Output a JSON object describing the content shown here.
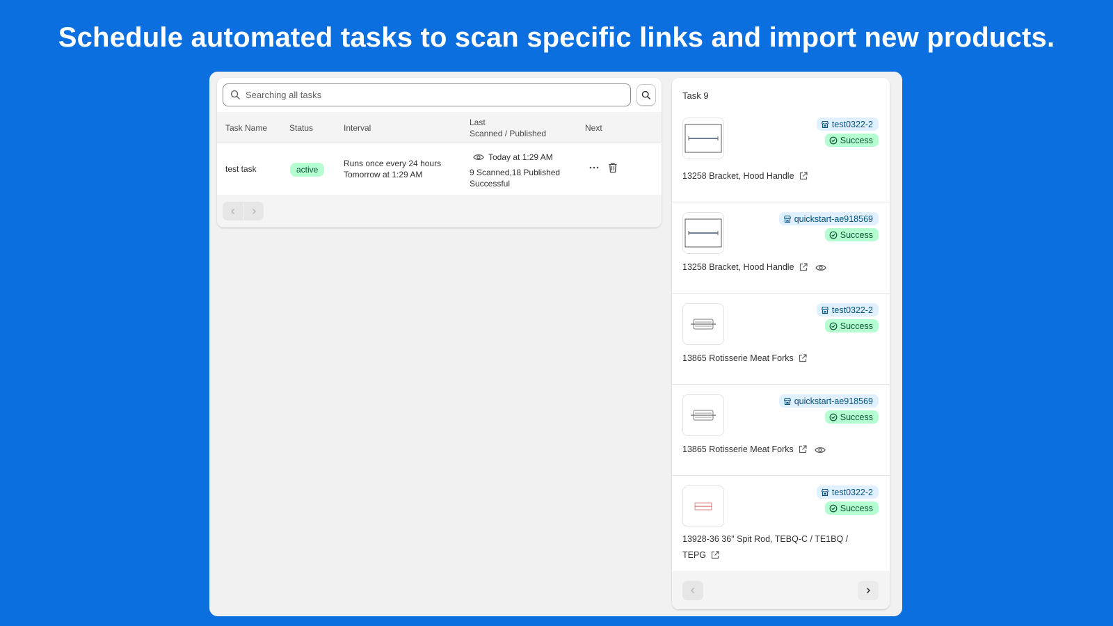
{
  "headline": "Schedule automated tasks to scan specific links and import new products.",
  "search": {
    "placeholder": "Searching all tasks"
  },
  "table": {
    "headers": {
      "task_name": "Task Name",
      "status": "Status",
      "interval": "Interval",
      "last_line1": "Last",
      "last_line2": "Scanned / Published",
      "next": "Next"
    },
    "rows": [
      {
        "task_name": "test task",
        "status": "active",
        "interval_line1": "Runs once every 24 hours",
        "interval_line2": "Tomorrow at 1:29 AM",
        "last_time": "Today at 1:29 AM",
        "last_counts": "9 Scanned,18 Published",
        "last_result": "Successful"
      }
    ]
  },
  "detail": {
    "title": "Task 9",
    "items": [
      {
        "store": "test0322-2",
        "status": "Success",
        "name": "13258 Bracket, Hood Handle",
        "thumb": "bracket-image",
        "show_eye": false
      },
      {
        "store": "quickstart-ae918569",
        "status": "Success",
        "name": "13258 Bracket, Hood Handle",
        "thumb": "bracket-image",
        "show_eye": true
      },
      {
        "store": "test0322-2",
        "status": "Success",
        "name": "13865 Rotisserie Meat Forks",
        "thumb": "forks-image",
        "show_eye": false
      },
      {
        "store": "quickstart-ae918569",
        "status": "Success",
        "name": "13865 Rotisserie Meat Forks",
        "thumb": "forks-image",
        "show_eye": true
      },
      {
        "store": "test0322-2",
        "status": "Success",
        "name_line1": "13928-36 36\" Spit Rod, TEBQ-C / TE1BQ /",
        "name_line2": "TEPG",
        "thumb": "spit-rod-image",
        "show_eye": false
      }
    ]
  },
  "icons": {
    "search": "search-icon",
    "eye": "eye-icon",
    "more": "more-horizontal-icon",
    "delete": "trash-icon",
    "store": "store-icon",
    "success": "check-circle-icon",
    "external": "external-link-icon",
    "prev": "chevron-left-icon",
    "next": "chevron-right-icon"
  },
  "colors": {
    "background": "#0b6fe0",
    "success_bg": "#b4fed2",
    "success_text": "#0c5132",
    "store_bg": "#e0f0ff",
    "store_text": "#00527c"
  }
}
